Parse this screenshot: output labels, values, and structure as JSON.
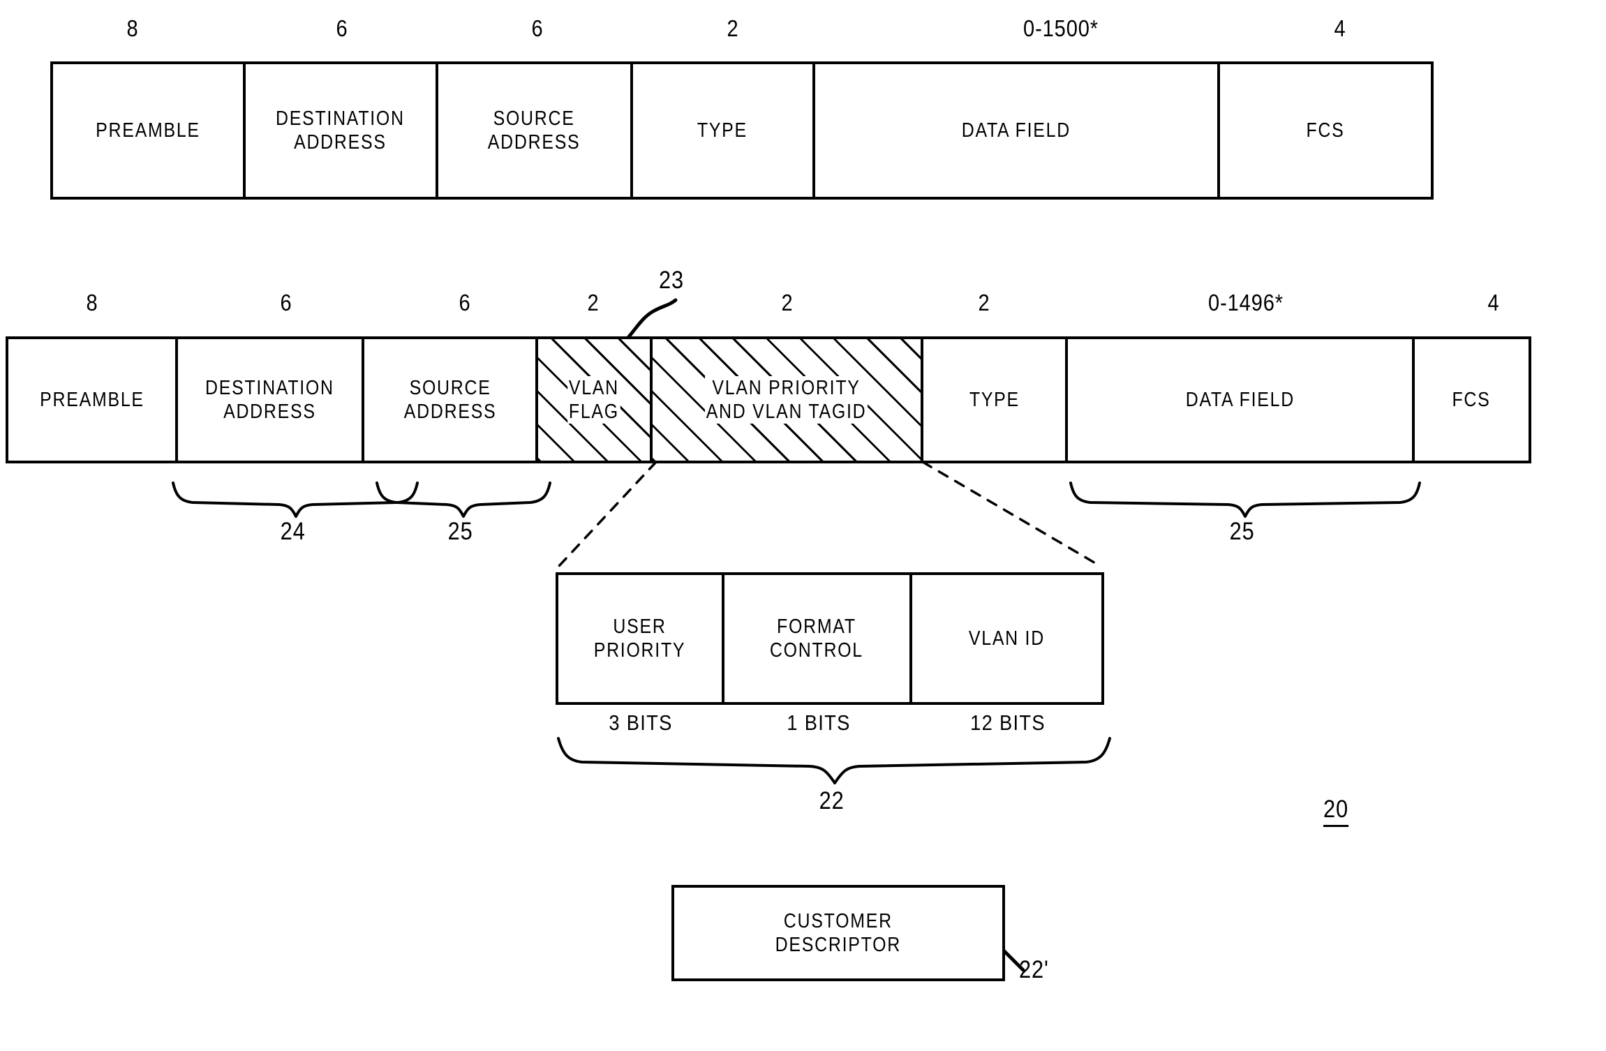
{
  "figure": {
    "reference_numeral": "20"
  },
  "frame_standard": {
    "sizes": [
      "8",
      "6",
      "6",
      "2",
      "0-1500*",
      "4"
    ],
    "cells": [
      {
        "label": "PREAMBLE",
        "hatched": false
      },
      {
        "label": "DESTINATION\nADDRESS",
        "hatched": false
      },
      {
        "label": "SOURCE\nADDRESS",
        "hatched": false
      },
      {
        "label": "TYPE",
        "hatched": false
      },
      {
        "label": "DATA FIELD",
        "hatched": false
      },
      {
        "label": "FCS",
        "hatched": false
      }
    ]
  },
  "frame_vlan": {
    "sizes": [
      "8",
      "6",
      "6",
      "2",
      "2",
      "2",
      "0-1496*",
      "4"
    ],
    "cells": [
      {
        "label": "PREAMBLE",
        "hatched": false
      },
      {
        "label": "DESTINATION\nADDRESS",
        "hatched": false
      },
      {
        "label": "SOURCE\nADDRESS",
        "hatched": false
      },
      {
        "label": "VLAN\nFLAG",
        "hatched": true
      },
      {
        "label": "VLAN PRIORITY\nAND VLAN TAGID",
        "hatched": true
      },
      {
        "label": "TYPE",
        "hatched": false
      },
      {
        "label": "DATA FIELD",
        "hatched": false
      },
      {
        "label": "FCS",
        "hatched": false
      }
    ],
    "callout_vlan_tag": "23",
    "brace_destination": "24",
    "brace_source": "25",
    "brace_data": "25"
  },
  "detail_tag": {
    "cells": [
      {
        "label": "USER\nPRIORITY",
        "bits": "3 BITS"
      },
      {
        "label": "FORMAT\nCONTROL",
        "bits": "1 BITS"
      },
      {
        "label": "VLAN ID",
        "bits": "12 BITS"
      }
    ],
    "brace_label": "22"
  },
  "customer_descriptor": {
    "label": "CUSTOMER\nDESCRIPTOR",
    "callout": "22'"
  }
}
